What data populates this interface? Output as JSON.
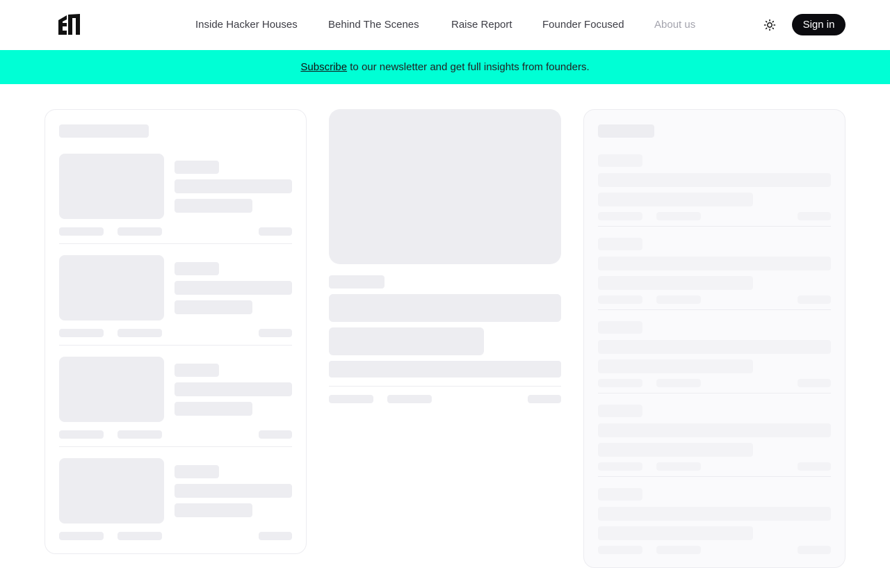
{
  "header": {
    "logo_icon": "site-logo-icon",
    "nav": [
      {
        "label": "Inside Hacker Houses"
      },
      {
        "label": "Behind The Scenes"
      },
      {
        "label": "Raise Report"
      },
      {
        "label": "Founder Focused"
      },
      {
        "label": "About us"
      }
    ],
    "theme_icon": "sun-icon",
    "signin_label": "Sign in"
  },
  "banner": {
    "link_text": "Subscribe",
    "text": " to our newsletter and get full insights from founders."
  },
  "colors": {
    "banner_bg": "#00ffd5",
    "button_bg": "#0b0b0f",
    "skeleton": "#ededf1"
  }
}
